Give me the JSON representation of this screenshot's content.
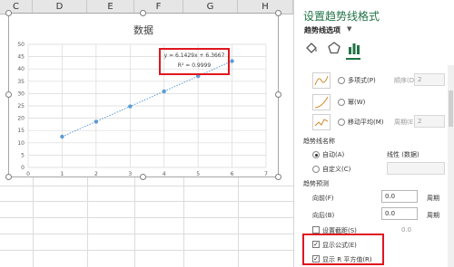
{
  "sheet": {
    "columns": [
      "C",
      "D",
      "E",
      "F",
      "G",
      "H"
    ]
  },
  "chart": {
    "equation": "y = 6.1429x + 6.3667",
    "r_squared": "R² = 0.9999"
  },
  "chart_data": {
    "type": "scatter",
    "title": "数据",
    "x": [
      1,
      2,
      3,
      4,
      5,
      6
    ],
    "y": [
      12.5,
      18.6,
      24.8,
      30.9,
      37.1,
      43.2
    ],
    "series": [
      {
        "values": [
          12.5,
          18.6,
          24.8,
          30.9,
          37.1,
          43.2
        ]
      }
    ],
    "trendline": {
      "type": "linear",
      "slope": 6.1429,
      "intercept": 6.3667
    },
    "xlim": [
      0,
      7
    ],
    "ylim": [
      0,
      50
    ],
    "xticks": [
      "0",
      "1",
      "2",
      "3",
      "4",
      "5",
      "6",
      "7"
    ],
    "yticks": [
      "0",
      "5",
      "10",
      "15",
      "20",
      "25",
      "30",
      "35",
      "40",
      "45",
      "50"
    ],
    "grid": true,
    "colors": {
      "marker": "#5b9bd5",
      "trendline": "#5b9bd5",
      "grid": "#d9d9d9",
      "highlight": "#e0161e"
    }
  },
  "pane": {
    "title": "设置趋势线格式",
    "subtitle": "趋势线选项",
    "tabs": [
      "fill-icon",
      "pentagon-icon",
      "bar-chart-icon"
    ],
    "poly_label": "多项式(P)",
    "order_label": "顺序(D)",
    "order_value": "2",
    "power_label": "幂(W)",
    "ma_label": "移动平均(M)",
    "period_label": "周期(E)",
    "period_value": "2",
    "name_section": "趋势线名称",
    "auto_label": "自动(A)",
    "auto_value": "线性 (数据)",
    "custom_label": "自定义(C)",
    "forecast_section": "趋势预测",
    "forward_label": "向前(F)",
    "forward_value": "0.0",
    "forward_unit": "周期",
    "backward_label": "向后(B)",
    "backward_value": "0.0",
    "backward_unit": "周期",
    "intercept_label": "设置截距(S)",
    "intercept_value": "0.0",
    "show_eq_label": "显示公式(E)",
    "show_r2_label": "显示 R 平方值(R)",
    "colors": {
      "title": "#217346",
      "highlight": "#e0161e"
    }
  }
}
